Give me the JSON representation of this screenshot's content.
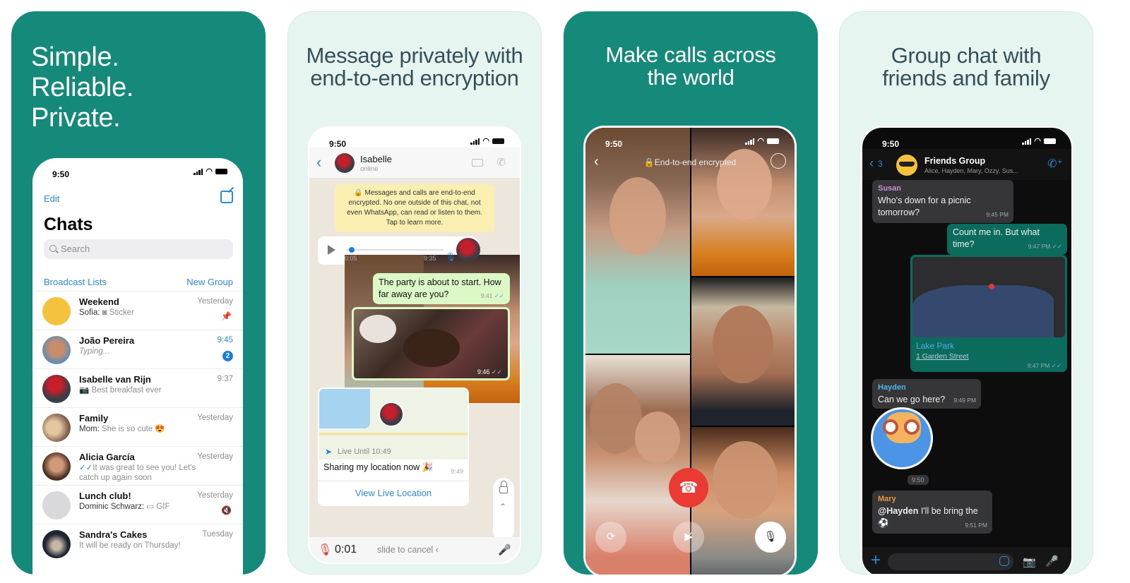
{
  "panels": [
    {
      "headline": [
        "Simple.",
        "Reliable.",
        "Private."
      ]
    },
    {
      "headline": [
        "Message privately with",
        "end-to-end encryption"
      ]
    },
    {
      "headline": [
        "Make calls across",
        "the world"
      ]
    },
    {
      "headline": [
        "Group chat with",
        "friends and family"
      ]
    }
  ],
  "status_time": "9:50",
  "chats_screen": {
    "edit_label": "Edit",
    "title": "Chats",
    "search_placeholder": "Search",
    "broadcast_label": "Broadcast Lists",
    "new_group_label": "New Group",
    "chats": [
      {
        "name": "Weekend",
        "sender": "Sofia:",
        "icon": "sticker-icon",
        "message": "Sticker",
        "time": "Yesterday",
        "indicator": "pin-icon"
      },
      {
        "name": "João Pereira",
        "message": "Typing...",
        "time": "9:45",
        "unread": "2"
      },
      {
        "name": "Isabelle van Rijn",
        "icon": "camera-icon",
        "message": "Best breakfast ever",
        "time": "9:37"
      },
      {
        "name": "Family",
        "sender": "Mom:",
        "message": "She is so cute 😍",
        "time": "Yesterday"
      },
      {
        "name": "Alicia García",
        "icon": "double-check-icon",
        "message": "It was great to see you! Let's catch up again soon",
        "time": "Yesterday"
      },
      {
        "name": "Lunch club!",
        "sender": "Dominic Schwarz:",
        "icon": "gif-icon",
        "message": "GIF",
        "time": "Yesterday",
        "indicator": "muted-icon"
      },
      {
        "name": "Sandra's Cakes",
        "message": "It will be ready on Thursday!",
        "time": "Tuesday"
      }
    ]
  },
  "private_chat": {
    "contact_name": "Isabelle",
    "contact_status": "online",
    "encryption_notice": "🔒 Messages and calls are end-to-end encrypted. No one outside of this chat, not even WhatsApp, can read or listen to them. Tap to learn more.",
    "voice_message": {
      "elapsed": "0:05",
      "time": "9:35",
      "progress": 0.05
    },
    "outgoing_text": {
      "text": "The party is about to start. How far away are you?",
      "time": "9:41"
    },
    "photo_message": {
      "time": "9:46"
    },
    "live_location": {
      "live_until": "Live Until 10:49",
      "caption": "Sharing my location now 🎉",
      "time": "9:49",
      "button": "View Live Location"
    },
    "recording": {
      "duration": "0:01",
      "slide_hint": "slide to cancel ‹"
    }
  },
  "group_call": {
    "encryption_label": "End-to-end encrypted",
    "participants": 5
  },
  "group_chat": {
    "back_count": "3",
    "group_name": "Friends Group",
    "members": "Alice, Hayden, Mary, Ozzy, Sus...",
    "messages": [
      {
        "sender": "Susan",
        "sender_color": "#c58fd6",
        "text": "Who's down for a picnic tomorrow?",
        "time": "9:45 PM",
        "direction": "in"
      },
      {
        "text": "Count me in. But what time?",
        "time": "9:47 PM",
        "direction": "out"
      },
      {
        "type": "location",
        "place": "Lake Park",
        "address": "1 Garden Street",
        "time": "9:47 PM",
        "direction": "out"
      },
      {
        "sender": "Hayden",
        "sender_color": "#4fb7e6",
        "text": "Can we go here?",
        "time": "9:49 PM",
        "direction": "in"
      },
      {
        "type": "sticker",
        "time": "9:50"
      },
      {
        "sender": "Mary",
        "sender_color": "#e9943a",
        "mention": "@Hayden",
        "text": " I'll be bring the ⚽",
        "time": "9:51 PM",
        "direction": "in"
      }
    ]
  }
}
